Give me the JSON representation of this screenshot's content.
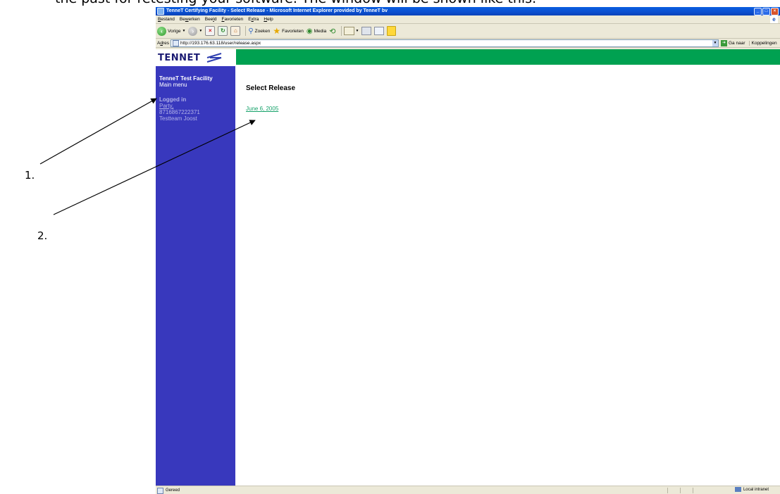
{
  "document": {
    "caption": "the past for retesting your software. The window will be shown like this.",
    "step_1": "1.",
    "step_2": "2."
  },
  "window": {
    "title": "TenneT Certifying Facility - Select Release - Microsoft Internet Explorer provided by TenneT bv"
  },
  "menubar": {
    "items": [
      {
        "u": "B",
        "rest": "estand"
      },
      {
        "pre": "Be",
        "u": "w",
        "rest": "erken"
      },
      {
        "pre": "Bee",
        "u": "l",
        "rest": "d"
      },
      {
        "u": "F",
        "rest": "avorieten"
      },
      {
        "pre": "E",
        "u": "x",
        "rest": "tra"
      },
      {
        "u": "H",
        "rest": "elp"
      }
    ]
  },
  "toolbar": {
    "back_label": "Vorige",
    "search_label": "Zoeken",
    "favorites_label": "Favorieten",
    "media_label": "Media"
  },
  "addressbar": {
    "label_u": "d",
    "label_pre": "A",
    "label_rest": "res",
    "url": "http://193.176.63.118/user/release.aspx",
    "go_label": "Ga naar",
    "links_label": "Koppelingen"
  },
  "page": {
    "logo": "TENNET",
    "sidebar": {
      "title": "TenneT Test Facility",
      "menu": "Main menu",
      "logged_in": "Logged in",
      "party": "Party,",
      "code": "8716867222371",
      "team": "Testteam Joost"
    },
    "heading": "Select Release",
    "release_link": "June 6, 2005"
  },
  "statusbar": {
    "status": "Gereed",
    "zone": "Local intranet"
  },
  "colors": {
    "sidebar": "#3838bd",
    "green_bar": "#00a151",
    "link": "#16a26a"
  }
}
